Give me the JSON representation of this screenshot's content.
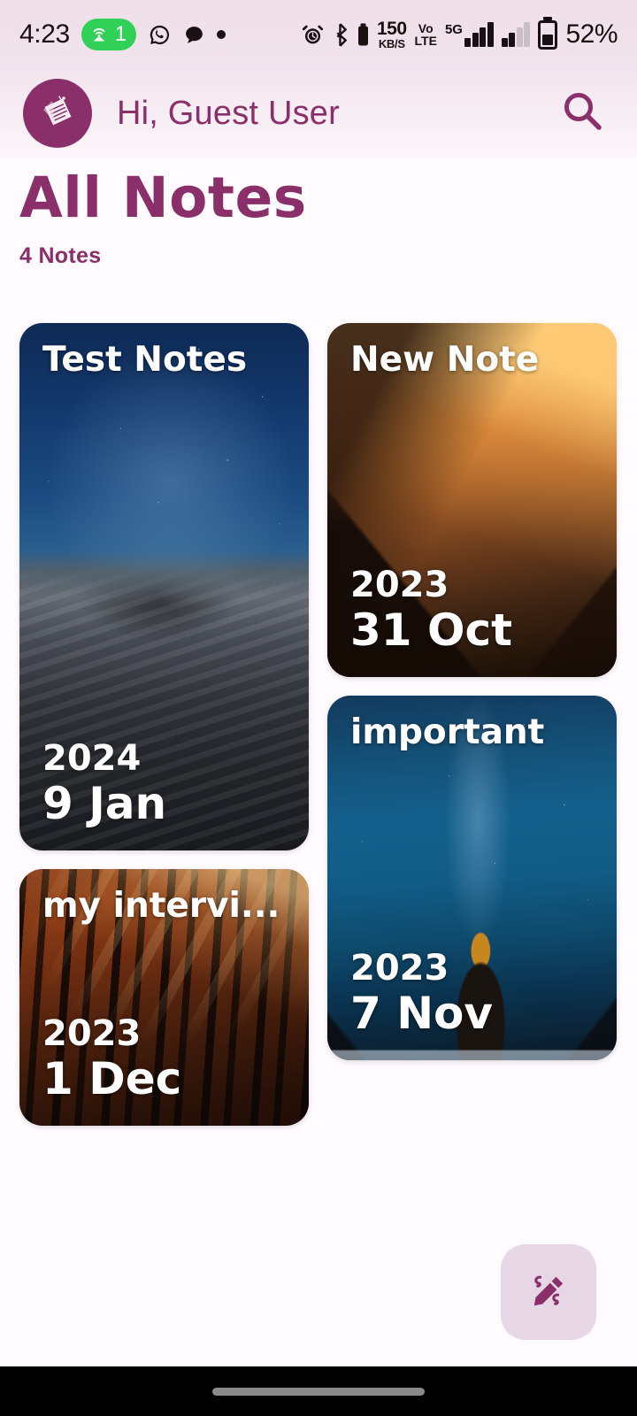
{
  "status_bar": {
    "time": "4:23",
    "hotspot_count": "1",
    "hotspot_icon": "hotspot-icon",
    "whatsapp_icon": "whatsapp-icon",
    "chat_bubble_icon": "chat-bubble-icon",
    "dot_icon": "dot-indicator-icon",
    "alarm_icon": "alarm-clock-icon",
    "bluetooth_icon": "bluetooth-icon",
    "bluetooth_battery_icon": "bluetooth-battery-icon",
    "network_speed_value": "150",
    "network_speed_unit": "KB/S",
    "volte_line1": "Vo",
    "volte_line2": "LTE",
    "network_type": "5G",
    "battery_percent": "52%"
  },
  "app_bar": {
    "avatar_icon": "notepad-icon",
    "greeting": "Hi, Guest User",
    "search_icon": "search-icon"
  },
  "header": {
    "title": "All Notes",
    "count_label": "4 Notes"
  },
  "notes": [
    {
      "title": "Test Notes",
      "year": "2024",
      "day": "9 Jan",
      "column": "left",
      "height_class": "card-h-596",
      "bg_class": "bg-dunes",
      "image_desc": "starry-night-sand-dunes"
    },
    {
      "title": "New Note",
      "year": "2023",
      "day": "31 Oct",
      "column": "right",
      "height_class": "card-h-400",
      "bg_class": "bg-mountains",
      "image_desc": "amber-mountain-sunset"
    },
    {
      "title": "important",
      "year": "2023",
      "day": "7 Nov",
      "column": "right",
      "height_class": "card-h-412",
      "bg_class": "bg-seastack",
      "image_desc": "sea-stack-milky-way"
    },
    {
      "title": "my intervi...",
      "year": "2023",
      "day": "1 Dec",
      "column": "left",
      "height_class": "card-h-290",
      "bg_class": "bg-forest",
      "image_desc": "autumn-forest-sun-rays"
    }
  ],
  "fab": {
    "icon": "edit-pencil-icon",
    "background": "#e7d6e4",
    "icon_color": "#8b2f6b"
  },
  "colors": {
    "brand_purple": "#8b2f6b",
    "page_background": "#fffbff",
    "status_bar_background": "#efdfe9",
    "hotspot_green": "#31d158",
    "nav_bar": "#000000"
  }
}
